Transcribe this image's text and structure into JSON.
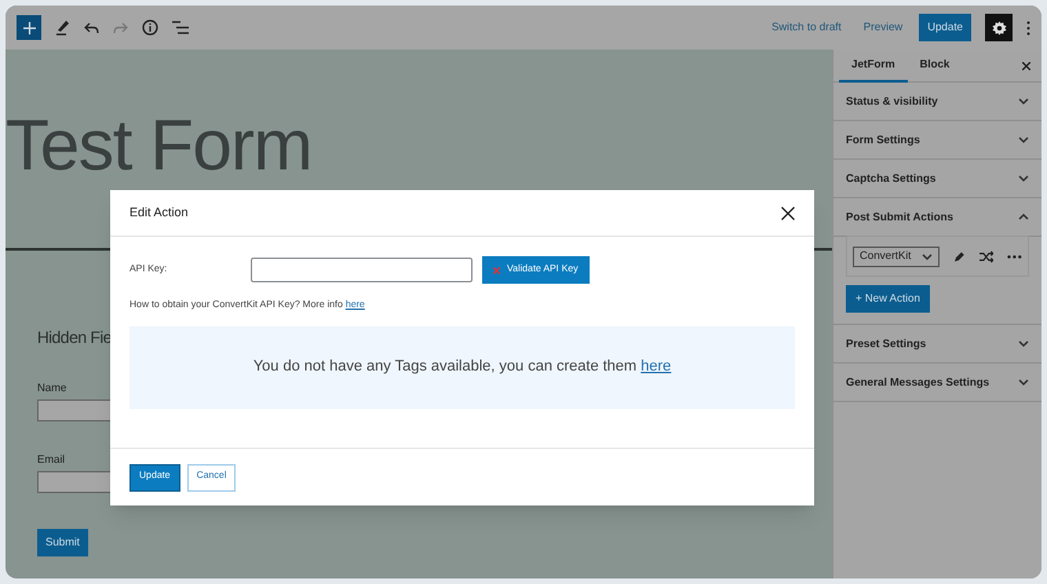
{
  "toolbar": {
    "switch_to_draft": "Switch to draft",
    "preview": "Preview",
    "update": "Update"
  },
  "editor": {
    "title": "Test Form",
    "section_heading": "Hidden Fie",
    "fields": [
      {
        "label": "Name"
      },
      {
        "label": "Email"
      }
    ],
    "submit": "Submit"
  },
  "sidebar": {
    "tabs": [
      {
        "label": "JetForm",
        "selected": true
      },
      {
        "label": "Block",
        "selected": false
      }
    ],
    "panels": [
      {
        "title": "Status & visibility",
        "expanded": false
      },
      {
        "title": "Form Settings",
        "expanded": false
      },
      {
        "title": "Captcha Settings",
        "expanded": false
      },
      {
        "title": "Post Submit Actions",
        "expanded": true
      },
      {
        "title": "Preset Settings",
        "expanded": false
      },
      {
        "title": "General Messages Settings",
        "expanded": false
      }
    ],
    "action_select": "ConvertKit",
    "new_action": "+ New Action"
  },
  "modal": {
    "title": "Edit Action",
    "api_key_label": "API Key:",
    "validate_button": "Validate API Key",
    "help_text": "How to obtain your ConvertKit API Key? More info",
    "help_link": "here",
    "notice_text": "You do not have any Tags available, you can create them",
    "notice_link": "here",
    "update_button": "Update",
    "cancel_button": "Cancel"
  }
}
